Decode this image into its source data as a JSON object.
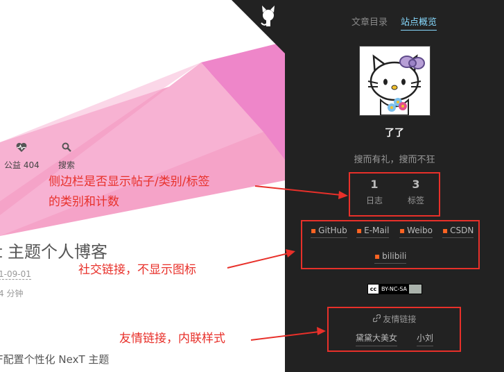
{
  "blog": {
    "menu": [
      {
        "label": "公益 404",
        "icon": "heartbeat-icon"
      },
      {
        "label": "搜索",
        "icon": "search-icon"
      }
    ],
    "post_title": "t 主题个人博客",
    "post_date": "1-09-01",
    "read_time": "4 分钟",
    "excerpt": "F配置个性化 NexT 主题"
  },
  "sidebar": {
    "tabs": [
      {
        "label": "文章目录",
        "active": false
      },
      {
        "label": "站点概览",
        "active": true
      }
    ],
    "author": "了了",
    "description": "搜而有礼，搜而不狂",
    "stats": [
      {
        "count": "1",
        "label": "日志"
      },
      {
        "count": "3",
        "label": "标签"
      }
    ],
    "social": [
      "GitHub",
      "E-Mail",
      "Weibo",
      "CSDN",
      "bilibili"
    ],
    "license": {
      "badge": "cc",
      "text": "BY-NC-SA"
    },
    "links_title": "友情链接",
    "links": [
      "黛黛大美女",
      "小刘"
    ]
  },
  "annotations": {
    "stats_note_line1": "侧边栏是否显示帖子/类别/标签",
    "stats_note_line2": "的类别和计数",
    "social_note": "社交链接，不显示图标",
    "links_note": "友情链接，内联样式"
  },
  "colors": {
    "sidebar_bg": "#222222",
    "tab_active": "#87daff",
    "social_dot": "#fc6423",
    "annotation_red": "#e8302a",
    "banner_pink": "#f5a3c8"
  }
}
